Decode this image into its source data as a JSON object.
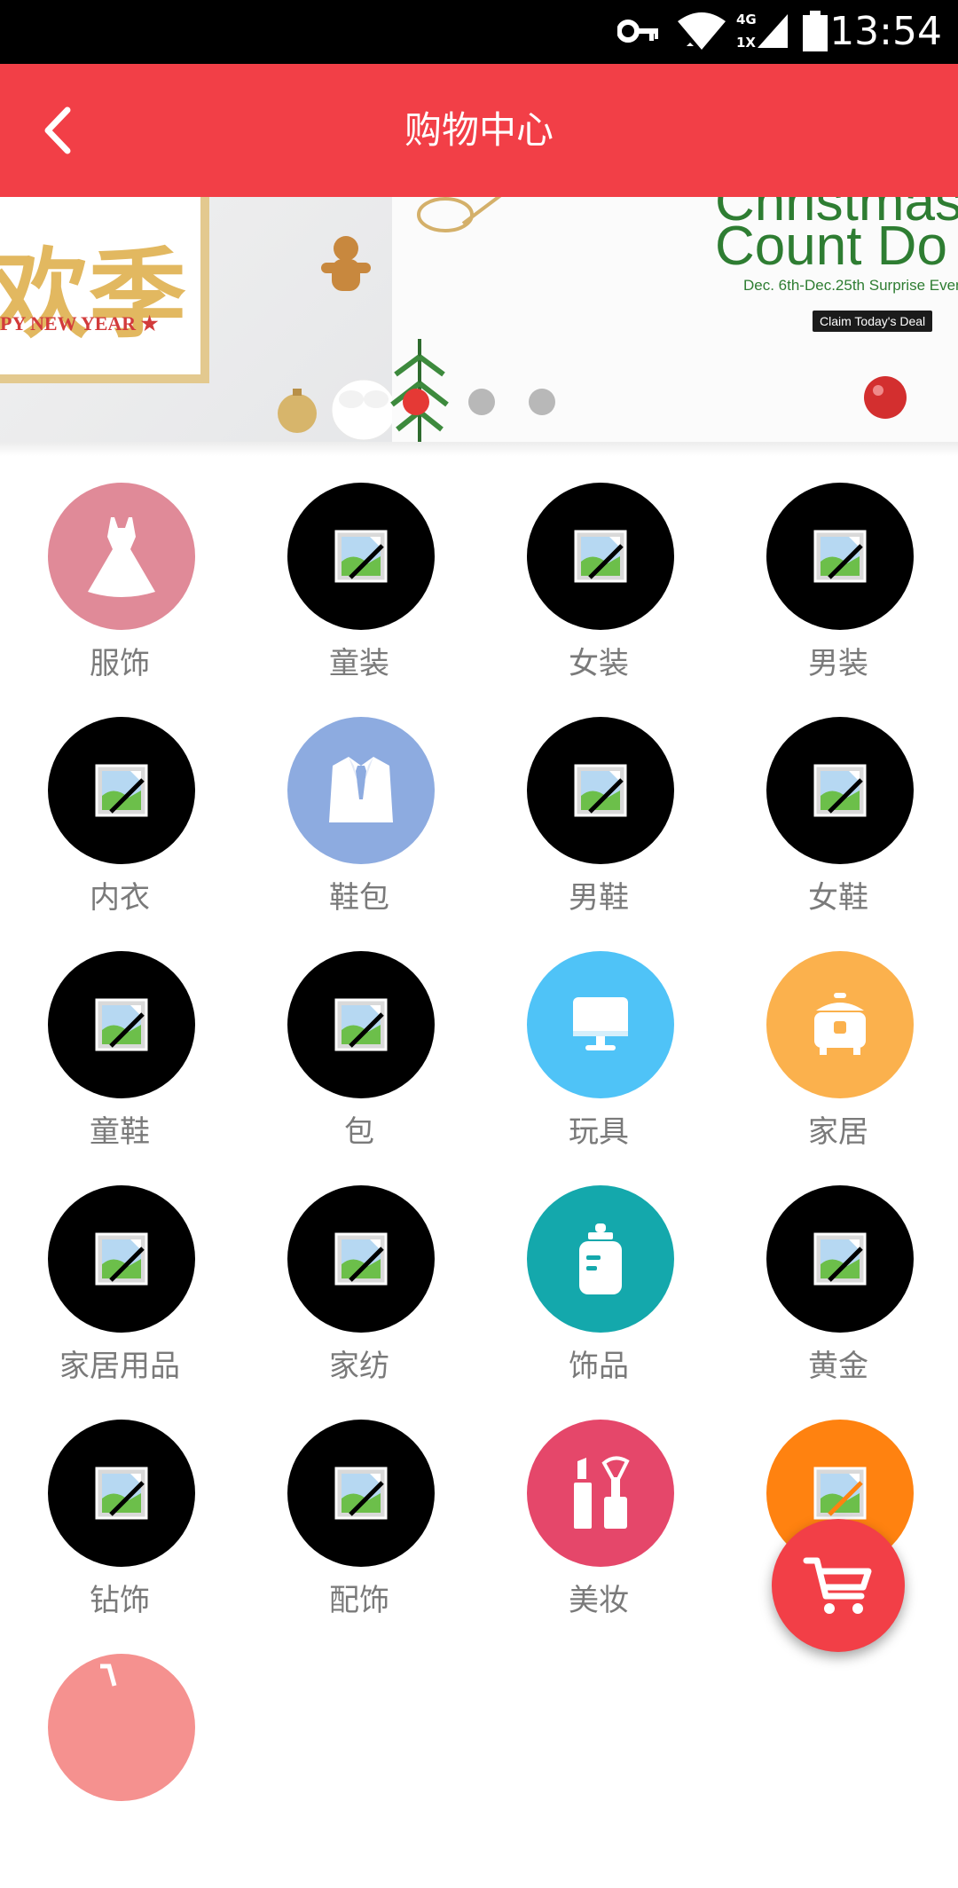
{
  "status_bar": {
    "time": "13:54",
    "network_top": "4G",
    "network_bottom": "1X",
    "icons": [
      "key-icon",
      "wifi-icon",
      "signal-icon",
      "battery-icon"
    ]
  },
  "header": {
    "title": "购物中心",
    "back_icon": "chevron-left-icon",
    "background": "#f23f47"
  },
  "banner": {
    "left_slide": {
      "headline": "欢季",
      "subline": "PY NEW YEAR ★"
    },
    "right_slide": {
      "line1": "Christmas",
      "line2": "Count Do",
      "dates": "Dec. 6th-Dec.25th Surprise Even",
      "button": "Claim Today's Deal"
    },
    "dots": [
      {
        "active": true,
        "color": "#e53935"
      },
      {
        "active": false,
        "color": "#b8b8b8"
      },
      {
        "active": false,
        "color": "#b8b8b8"
      }
    ]
  },
  "categories": [
    {
      "label": "服饰",
      "icon": "dress-icon",
      "color": "#e08a98"
    },
    {
      "label": "童装",
      "icon": "image-placeholder-icon",
      "color": "#000000"
    },
    {
      "label": "女装",
      "icon": "image-placeholder-icon",
      "color": "#000000"
    },
    {
      "label": "男装",
      "icon": "image-placeholder-icon",
      "color": "#000000"
    },
    {
      "label": "内衣",
      "icon": "image-placeholder-icon",
      "color": "#000000"
    },
    {
      "label": "鞋包",
      "icon": "suit-icon",
      "color": "#8dabe0"
    },
    {
      "label": "男鞋",
      "icon": "image-placeholder-icon",
      "color": "#000000"
    },
    {
      "label": "女鞋",
      "icon": "image-placeholder-icon",
      "color": "#000000"
    },
    {
      "label": "童鞋",
      "icon": "image-placeholder-icon",
      "color": "#000000"
    },
    {
      "label": "包",
      "icon": "image-placeholder-icon",
      "color": "#000000"
    },
    {
      "label": "玩具",
      "icon": "monitor-icon",
      "color": "#4fc3f7"
    },
    {
      "label": "家居",
      "icon": "rice-cooker-icon",
      "color": "#fbb14d"
    },
    {
      "label": "家居用品",
      "icon": "image-placeholder-icon",
      "color": "#000000"
    },
    {
      "label": "家纺",
      "icon": "image-placeholder-icon",
      "color": "#000000"
    },
    {
      "label": "饰品",
      "icon": "baby-bottle-icon",
      "color": "#14a8ac"
    },
    {
      "label": "黄金",
      "icon": "image-placeholder-icon",
      "color": "#000000"
    },
    {
      "label": "钻饰",
      "icon": "image-placeholder-icon",
      "color": "#000000"
    },
    {
      "label": "配饰",
      "icon": "image-placeholder-icon",
      "color": "#000000"
    },
    {
      "label": "美妆",
      "icon": "cosmetics-icon",
      "color": "#e5476a"
    },
    {
      "label": "",
      "icon": "image-placeholder-icon",
      "color": "#ff8210"
    },
    {
      "label": "",
      "icon": "cart-icon",
      "color": "#f5918f"
    }
  ],
  "cart_fab": {
    "icon": "cart-icon",
    "color": "#f23f47"
  }
}
